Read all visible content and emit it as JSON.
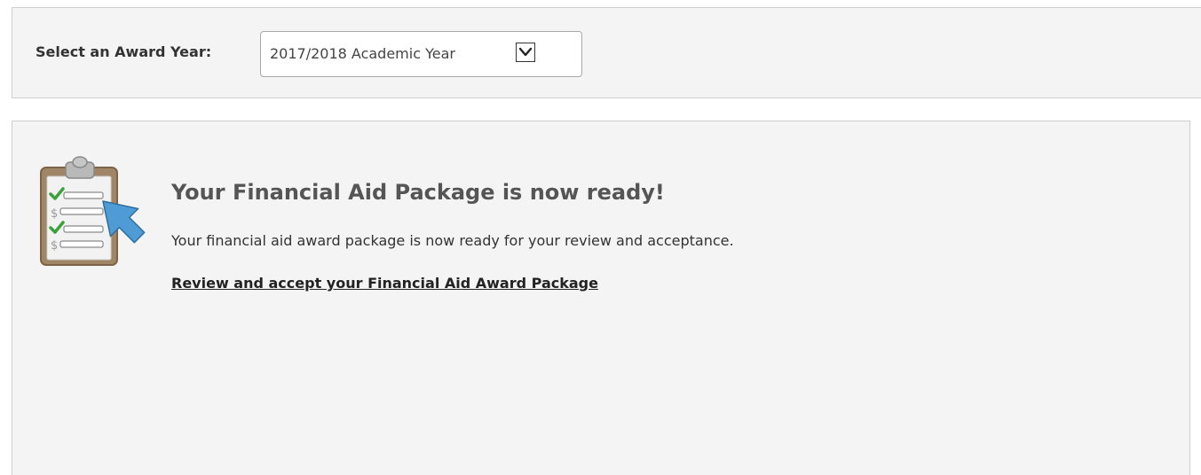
{
  "award_year": {
    "label": "Select an Award Year:",
    "selected_value": "2017/2018 Academic Year",
    "arrow_icon": "chevron-down-icon"
  },
  "package": {
    "icon": "clipboard-checklist-icon",
    "title": "Your Financial Aid Package is now ready!",
    "message": "Your financial aid award package is now ready for your review and acceptance.",
    "link_text": "Review and accept your Financial Aid Award Package"
  },
  "colors": {
    "panel_background": "#f4f4f4",
    "panel_border": "#cfcfcf",
    "check_green": "#3aa23a",
    "arrow_blue": "#4e9bd6"
  }
}
